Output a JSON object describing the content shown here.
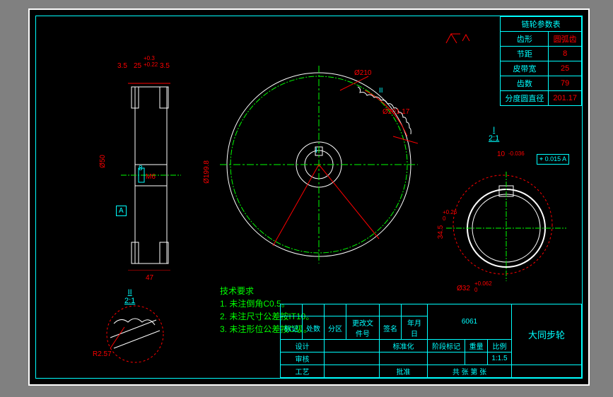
{
  "param_table": {
    "title": "链轮参数表",
    "rows": [
      {
        "label": "齿形",
        "value": "圆弧齿"
      },
      {
        "label": "节距",
        "value": "8"
      },
      {
        "label": "皮带宽",
        "value": "25"
      },
      {
        "label": "齿数",
        "value": "79"
      },
      {
        "label": "分度圆直径",
        "value": "201.17"
      }
    ]
  },
  "dimensions": {
    "d35a": "3.5",
    "d25": "25",
    "d25_tol": "+0.3\n+0.22",
    "d35b": "3.5",
    "d50": "Ø50",
    "d8": "8",
    "m6": "M6",
    "d199": "Ø199.8",
    "d47": "47",
    "d210": "Ø210",
    "d201": "Ø201.17",
    "section_i": "I",
    "section_ii": "II",
    "d10": "10",
    "d10_tol": "-0.036",
    "d345": "34.5",
    "d345_tol": "+0.26\n0",
    "d32": "Ø32",
    "d32_tol": "+0.062\n0",
    "r257": "R2.57",
    "scale_ii": "II\n2:1",
    "scale_i": "I\n2:1",
    "gtol": "⌖ 0.015 A"
  },
  "tech_req": {
    "title": "技术要求",
    "items": [
      "1. 未注倒角C0.5。",
      "2. 未注尺寸公差按IT10。",
      "3. 未注形位公差按C级。"
    ]
  },
  "title_block": {
    "material": "6061",
    "name": "大同步轮",
    "scale": "1:1.5",
    "labels": {
      "mark": "标记",
      "place": "处数",
      "zone": "分区",
      "file": "更改文件号",
      "sign": "签名",
      "date": "年月日",
      "stage": "阶段标记",
      "weight": "重量",
      "proportion": "比例",
      "design": "设计",
      "check": "审核",
      "craft": "工艺",
      "approve": "批准",
      "std": "标准化",
      "total": "共  张  第  张"
    }
  },
  "datum": "A",
  "chart_data": {
    "type": "table",
    "title": "链轮参数表",
    "rows": [
      [
        "齿形",
        "圆弧齿"
      ],
      [
        "节距",
        8
      ],
      [
        "皮带宽",
        25
      ],
      [
        "齿数",
        79
      ],
      [
        "分度圆直径",
        201.17
      ]
    ]
  }
}
